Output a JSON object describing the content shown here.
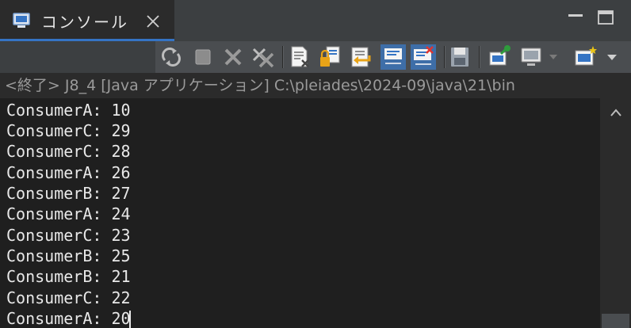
{
  "tab": {
    "label": "コンソール",
    "icon": "console-icon",
    "close_icon": "close-icon"
  },
  "window": {
    "minimize_icon": "minimize-icon",
    "maximize_icon": "maximize-icon"
  },
  "toolbar": {
    "buttons": [
      "pin-sync-icon",
      "stop-icon",
      "remove-launch-icon",
      "remove-all-icon",
      "clear-console-icon",
      "scroll-lock-icon",
      "word-wrap-icon",
      "show-on-stdout-icon",
      "show-on-stderr-icon",
      "save-output-icon",
      "pin-console-icon",
      "display-console-icon",
      "open-console-icon"
    ]
  },
  "status": {
    "text": "<終了> J8_4 [Java アプリケーション] C:\\pleiades\\2024-09\\java\\21\\bin"
  },
  "console": {
    "lines": [
      "ConsumerA: 10",
      "ConsumerC: 29",
      "ConsumerC: 28",
      "ConsumerA: 26",
      "ConsumerB: 27",
      "ConsumerA: 24",
      "ConsumerC: 23",
      "ConsumerB: 25",
      "ConsumerB: 21",
      "ConsumerC: 22",
      "ConsumerA: 20"
    ]
  },
  "colors": {
    "accent": "#3574c4",
    "background": "#1f1f1f",
    "text": "#e8e8e8",
    "status_text": "#9a9a9a"
  }
}
